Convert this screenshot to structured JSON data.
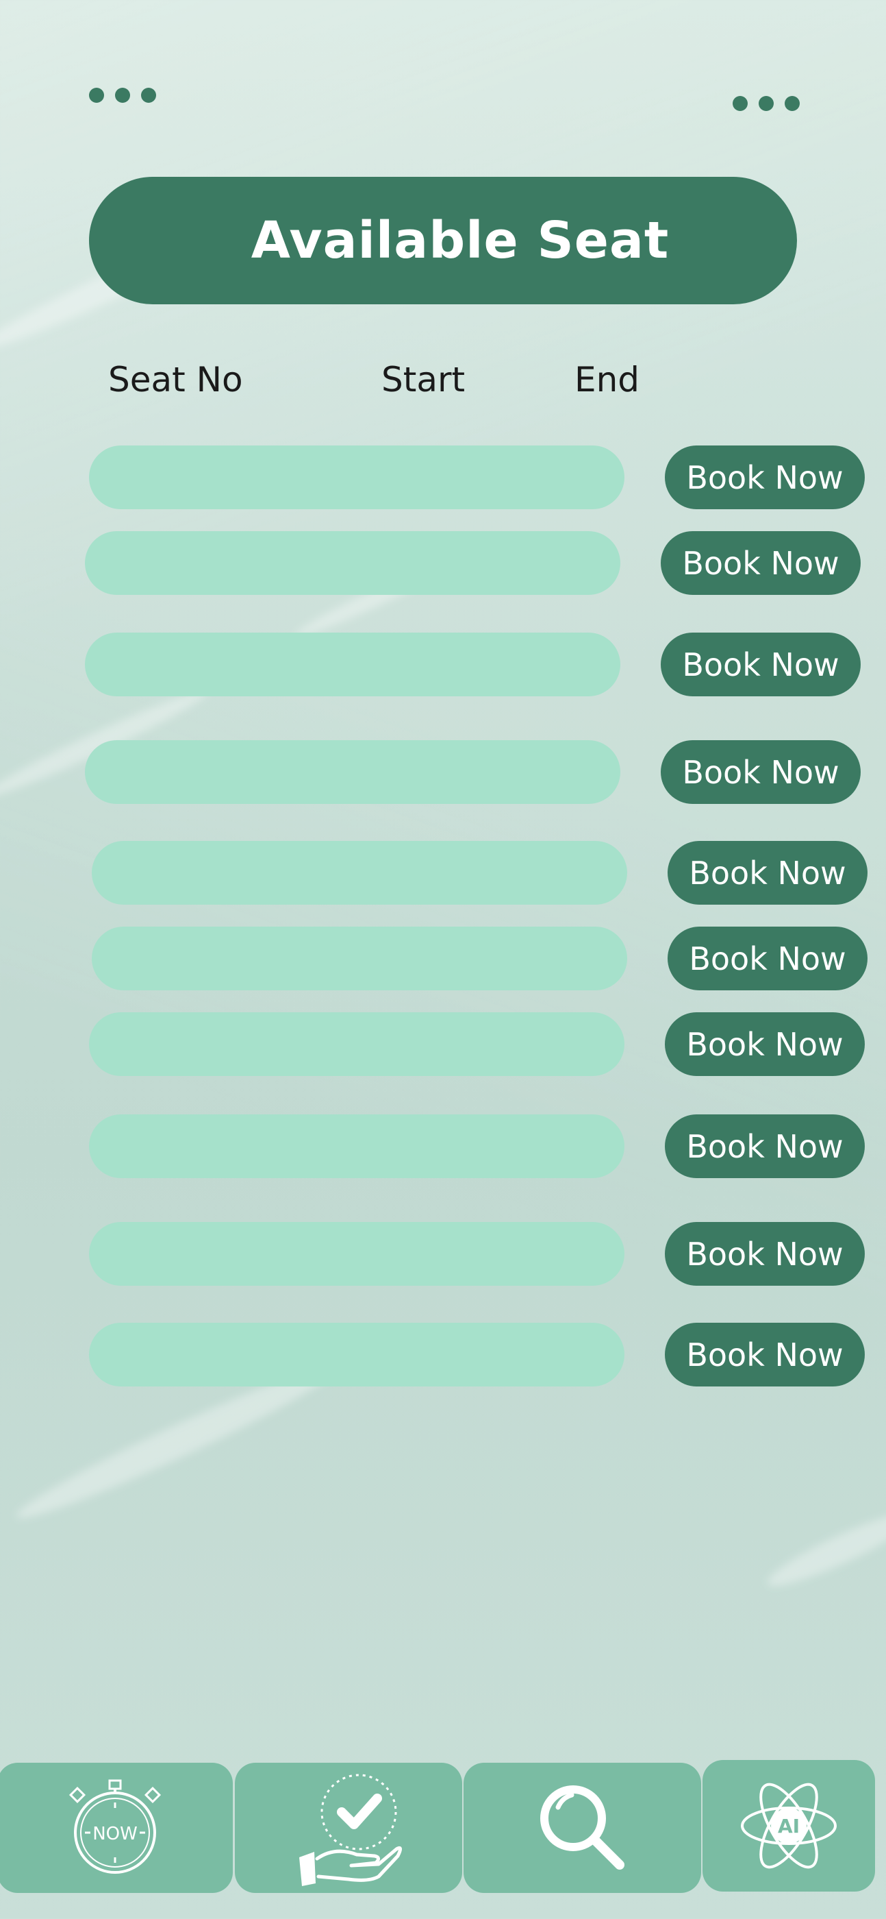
{
  "header": {
    "title": "Available Seat"
  },
  "columns": {
    "seat_no": "Seat No",
    "start": "Start",
    "end": "End"
  },
  "rows": [
    {
      "button_label": "Book Now"
    },
    {
      "button_label": "Book Now"
    },
    {
      "button_label": "Book Now"
    },
    {
      "button_label": "Book Now"
    },
    {
      "button_label": "Book Now"
    },
    {
      "button_label": "Book Now"
    },
    {
      "button_label": "Book Now"
    },
    {
      "button_label": "Book Now"
    },
    {
      "button_label": "Book Now"
    },
    {
      "button_label": "Book Now"
    }
  ],
  "tab_bar": {
    "tabs": [
      {
        "icon": "stopwatch-icon",
        "label": "NOW"
      },
      {
        "icon": "hand-check-icon"
      },
      {
        "icon": "search-icon"
      },
      {
        "icon": "ai-atom-icon",
        "label": "AI"
      }
    ]
  },
  "colors": {
    "accent": "#3b7a62",
    "row_fill": "#a6e1cb",
    "tab_fill": "#7abca3",
    "background": "#c6ddd5"
  }
}
